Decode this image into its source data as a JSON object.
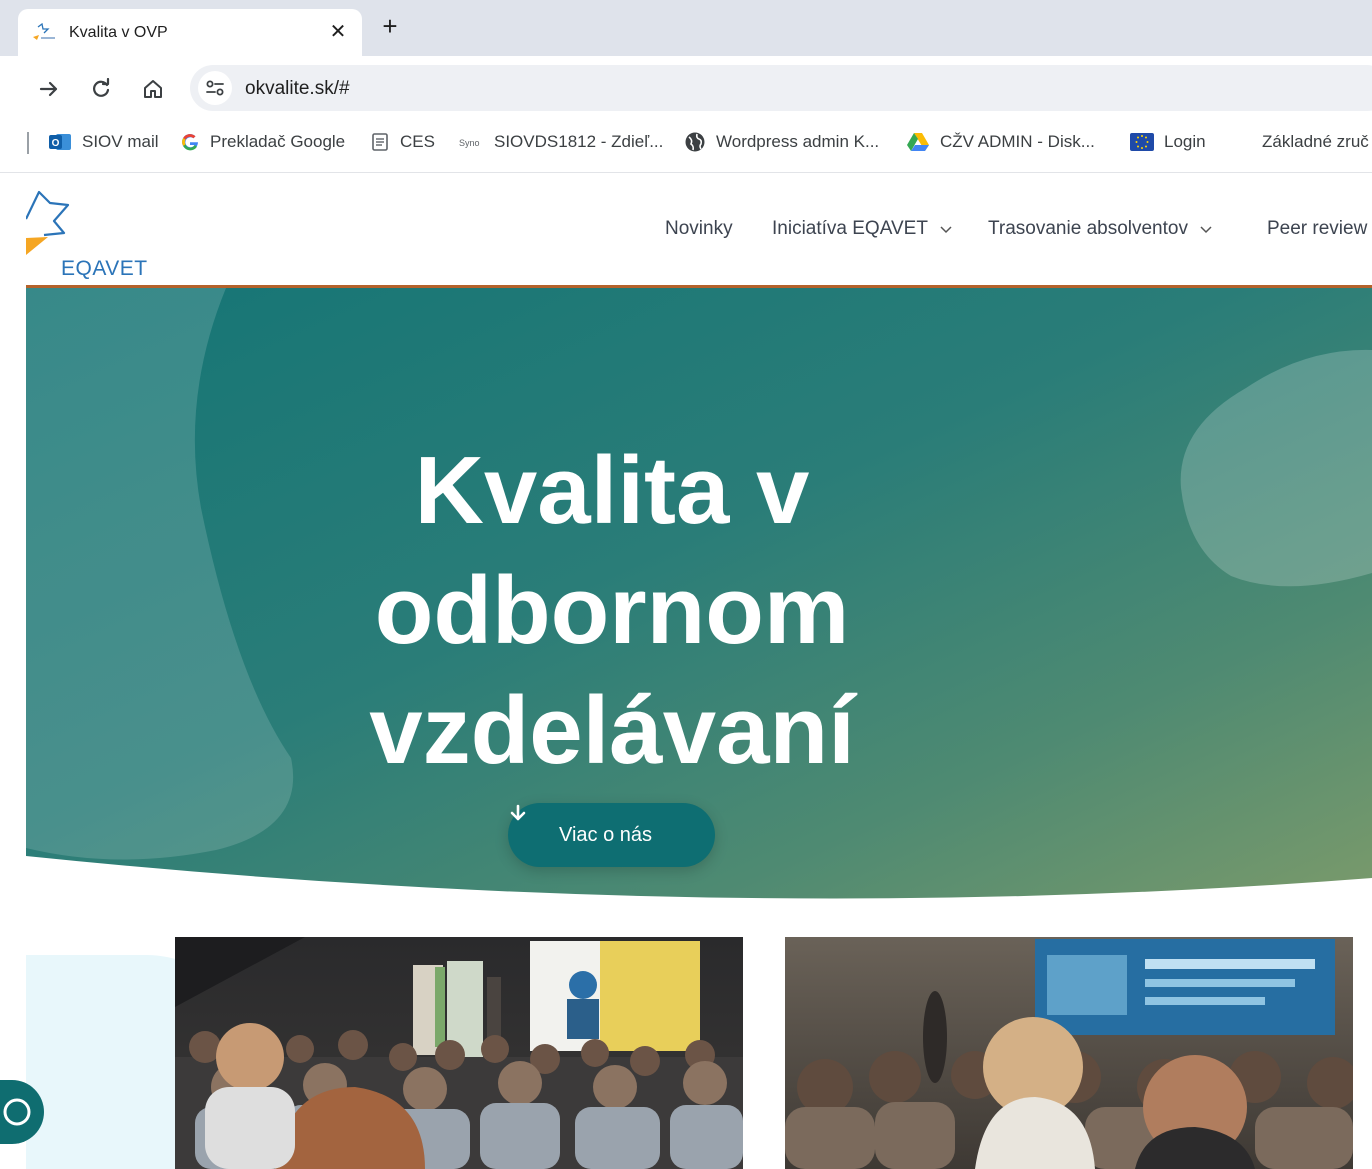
{
  "browser": {
    "tab": {
      "title": "Kvalita v OVP"
    },
    "omnibox": {
      "url": "okvalite.sk/#"
    },
    "bookmarks": [
      {
        "label": "SIOV mail",
        "icon": "outlook-icon"
      },
      {
        "label": "Prekladač Google",
        "icon": "google-icon"
      },
      {
        "label": "CES",
        "icon": "document-icon"
      },
      {
        "label": "SIOVDS1812 - Zdieľ...",
        "icon": "synology-icon"
      },
      {
        "label": "Wordpress admin K...",
        "icon": "globe-icon"
      },
      {
        "label": "CŽV ADMIN - Disk...",
        "icon": "google-drive-icon"
      },
      {
        "label": "Login",
        "icon": "eu-flag-icon"
      },
      {
        "label": "Základné zruč",
        "icon": ""
      }
    ]
  },
  "site": {
    "logo_text": "EQAVET",
    "nav": [
      {
        "label": "Novinky",
        "has_dropdown": false
      },
      {
        "label": "Iniciatíva EQAVET",
        "has_dropdown": true
      },
      {
        "label": "Trasovanie absolventov",
        "has_dropdown": true
      },
      {
        "label": "Peer review",
        "has_dropdown": false
      }
    ],
    "hero": {
      "title_lines": [
        "Kvalita v",
        "odbornom",
        "vzdelávaní"
      ],
      "button_label": "Viac o nás"
    }
  },
  "colors": {
    "accent_line": "#b4622b",
    "hero_teal": "#1d7a7b",
    "hero_olive": "#7a9a6b",
    "button_teal": "#0e6e72",
    "logo_blue": "#2b74b8",
    "logo_orange": "#f5a623"
  }
}
